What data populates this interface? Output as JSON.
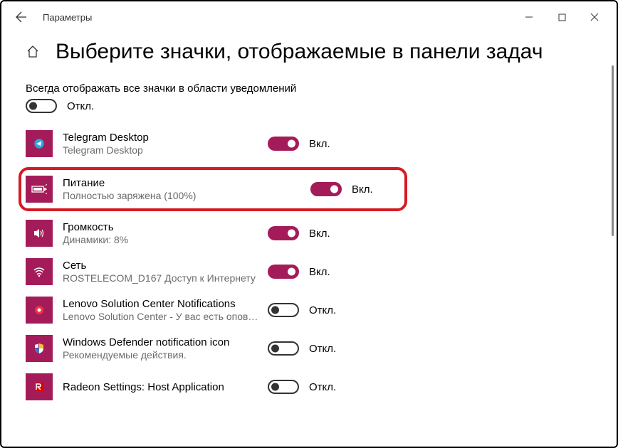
{
  "window": {
    "title": "Параметры"
  },
  "page": {
    "heading": "Выберите значки, отображаемые в панели задач",
    "master_label": "Всегда отображать все значки в области уведомлений",
    "master_state_label": "Откл.",
    "master_on": false
  },
  "labels": {
    "on": "Вкл.",
    "off": "Откл."
  },
  "items": [
    {
      "title": "Telegram Desktop",
      "sub": "Telegram Desktop",
      "on": true,
      "highlight": false,
      "icon": "telegram"
    },
    {
      "title": "Питание",
      "sub": "Полностью заряжена (100%)",
      "on": true,
      "highlight": true,
      "icon": "battery"
    },
    {
      "title": "Громкость",
      "sub": "Динамики: 8%",
      "on": true,
      "highlight": false,
      "icon": "volume"
    },
    {
      "title": "Сеть",
      "sub": "ROSTELECOM_D167 Доступ к Интернету",
      "on": true,
      "highlight": false,
      "icon": "wifi"
    },
    {
      "title": "Lenovo Solution Center Notifications",
      "sub": "Lenovo Solution Center - У вас есть опове…",
      "on": false,
      "highlight": false,
      "icon": "lenovo"
    },
    {
      "title": "Windows Defender notification icon",
      "sub": "Рекомендуемые действия.",
      "on": false,
      "highlight": false,
      "icon": "defender"
    },
    {
      "title": "Radeon Settings: Host Application",
      "sub": "",
      "on": false,
      "highlight": false,
      "icon": "radeon"
    }
  ]
}
